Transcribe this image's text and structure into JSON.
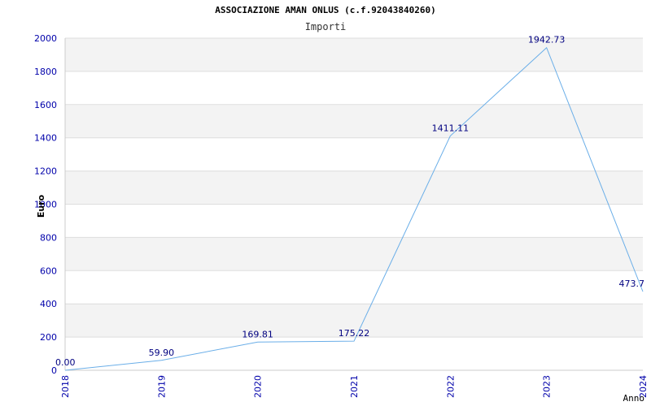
{
  "chart_data": {
    "type": "line",
    "title": "ASSOCIAZIONE AMAN ONLUS (c.f.92043840260)",
    "subtitle": "Importi",
    "xlabel": "Anno",
    "ylabel": "Euro",
    "categories": [
      "2018",
      "2019",
      "2020",
      "2021",
      "2022",
      "2023",
      "2024"
    ],
    "values": [
      0.0,
      59.9,
      169.81,
      175.22,
      1411.11,
      1942.73,
      473.7
    ],
    "data_labels": [
      "0.00",
      "59.90",
      "169.81",
      "175.22",
      "1411.11",
      "1942.73",
      "473.7"
    ],
    "ylim": [
      0,
      2000
    ],
    "yticks": [
      "0",
      "200",
      "400",
      "600",
      "800",
      "1000",
      "1200",
      "1400",
      "1600",
      "1800",
      "2000"
    ],
    "grid": true,
    "colors": {
      "line": "#6aaee8",
      "labels": "#000080",
      "tick_labels": "#0000aa",
      "band": "#f3f3f3",
      "grid": "#dddddd"
    }
  }
}
